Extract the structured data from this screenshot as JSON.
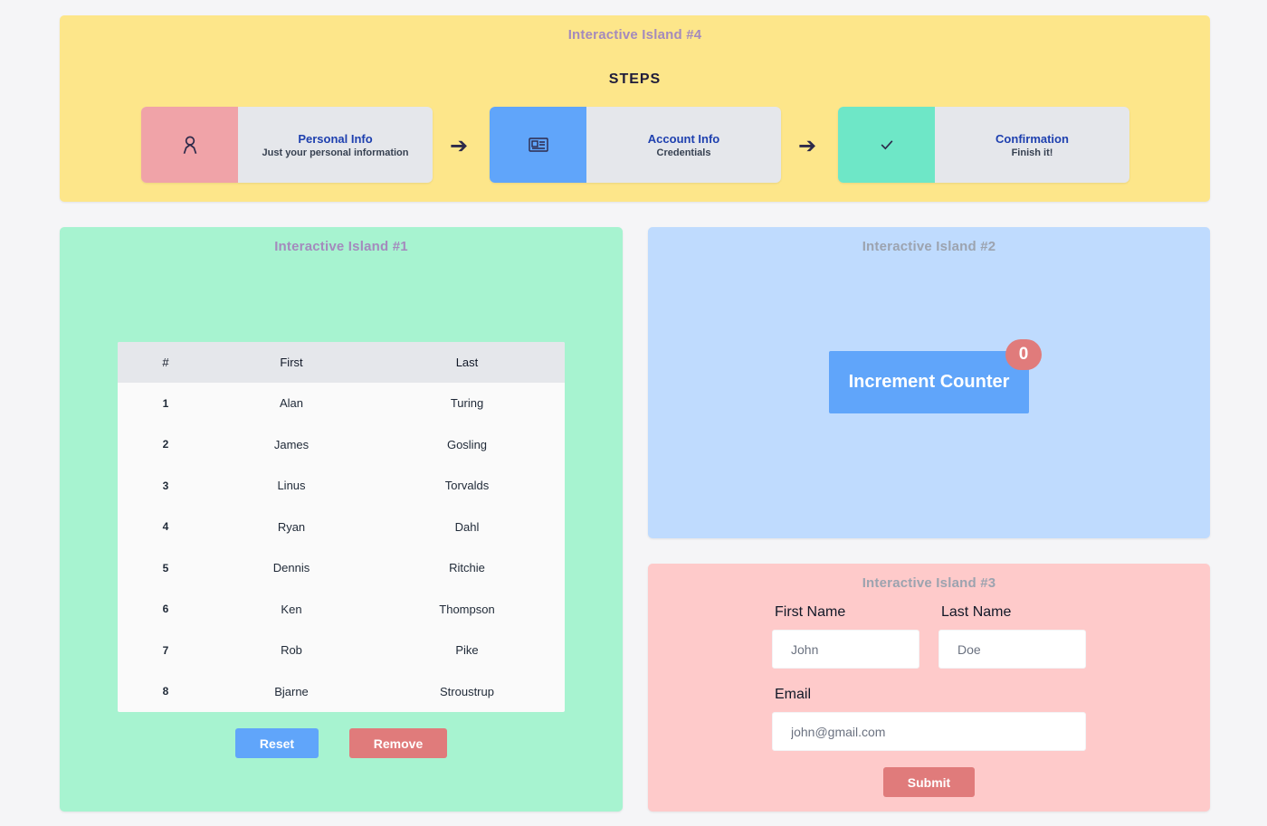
{
  "island4": {
    "title": "Interactive Island #4",
    "heading": "STEPS",
    "steps": [
      {
        "title": "Personal Info",
        "subtitle": "Just your personal information",
        "icon": "user-icon",
        "color": "#f0a3a8"
      },
      {
        "title": "Account Info",
        "subtitle": "Credentials",
        "icon": "id-card-icon",
        "color": "#60a5fa"
      },
      {
        "title": "Confirmation",
        "subtitle": "Finish it!",
        "icon": "check-icon",
        "color": "#6ee7c7"
      }
    ],
    "arrow": "➔"
  },
  "island1": {
    "title": "Interactive Island #1",
    "table": {
      "headers": [
        "#",
        "First",
        "Last"
      ],
      "rows": [
        [
          "1",
          "Alan",
          "Turing"
        ],
        [
          "2",
          "James",
          "Gosling"
        ],
        [
          "3",
          "Linus",
          "Torvalds"
        ],
        [
          "4",
          "Ryan",
          "Dahl"
        ],
        [
          "5",
          "Dennis",
          "Ritchie"
        ],
        [
          "6",
          "Ken",
          "Thompson"
        ],
        [
          "7",
          "Rob",
          "Pike"
        ],
        [
          "8",
          "Bjarne",
          "Stroustrup"
        ]
      ]
    },
    "reset_label": "Reset",
    "remove_label": "Remove"
  },
  "island2": {
    "title": "Interactive Island #2",
    "button_label": "Increment Counter",
    "count": "0"
  },
  "island3": {
    "title": "Interactive Island #3",
    "first_name_label": "First Name",
    "first_name_placeholder": "John",
    "last_name_label": "Last Name",
    "last_name_placeholder": "Doe",
    "email_label": "Email",
    "email_placeholder": "john@gmail.com",
    "submit_label": "Submit"
  }
}
